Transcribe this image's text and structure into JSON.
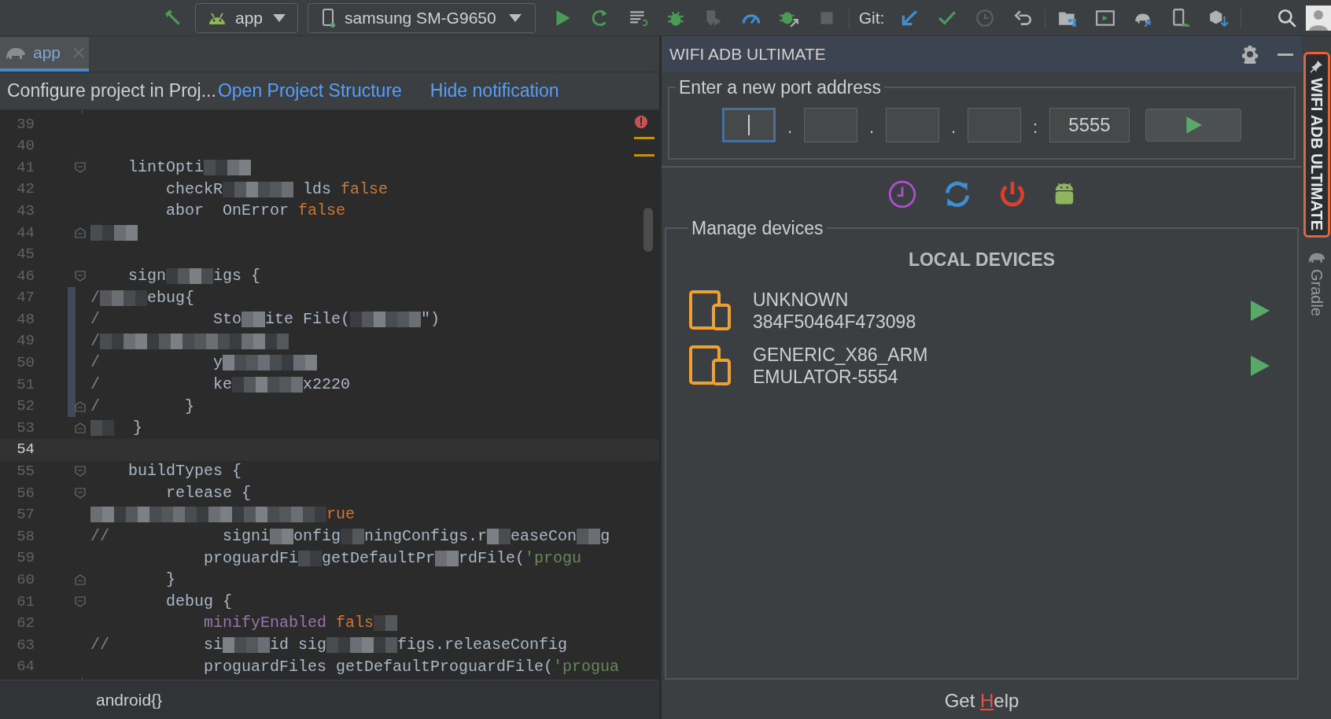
{
  "toolbar": {
    "run_config": "app",
    "device": "samsung SM-G9650",
    "git_label": "Git:"
  },
  "editor_tabs": [
    {
      "label": "app",
      "selected": true
    }
  ],
  "notification": {
    "message": "Configure project in Proj...",
    "actions": [
      "Open Project Structure",
      "Hide notification"
    ]
  },
  "code_lines": [
    {
      "number": "39",
      "current": false,
      "fold_start": false,
      "fold_end": false,
      "changed": false
    },
    {
      "number": "40",
      "current": false,
      "fold_start": false,
      "fold_end": false,
      "changed": false
    },
    {
      "number": "41",
      "current": false,
      "fold_start": true,
      "fold_end": false,
      "changed": false,
      "segments": [
        {
          "kind": "plain",
          "text": "    lintOpti"
        },
        {
          "kind": "blur"
        },
        {
          "kind": "blur"
        }
      ]
    },
    {
      "number": "42",
      "current": false,
      "fold_start": false,
      "fold_end": false,
      "changed": false,
      "segments": [
        {
          "kind": "plain",
          "text": "        checkR"
        },
        {
          "kind": "blur"
        },
        {
          "kind": "blur"
        },
        {
          "kind": "blur"
        },
        {
          "kind": "plain",
          "text": " lds "
        },
        {
          "kind": "keyword",
          "text": "false"
        }
      ]
    },
    {
      "number": "43",
      "current": false,
      "fold_start": false,
      "fold_end": false,
      "changed": false,
      "segments": [
        {
          "kind": "plain",
          "text": "        abor  OnError "
        },
        {
          "kind": "keyword",
          "text": "false"
        }
      ]
    },
    {
      "number": "44",
      "current": false,
      "fold_start": false,
      "fold_end": true,
      "changed": false,
      "segments": [
        {
          "kind": "blur"
        },
        {
          "kind": "blur"
        }
      ]
    },
    {
      "number": "45",
      "current": false,
      "fold_start": false,
      "fold_end": false,
      "changed": false
    },
    {
      "number": "46",
      "current": false,
      "fold_start": true,
      "fold_end": false,
      "changed": false,
      "segments": [
        {
          "kind": "plain",
          "text": "    sign"
        },
        {
          "kind": "blur"
        },
        {
          "kind": "blur"
        },
        {
          "kind": "plain",
          "text": "igs {"
        }
      ]
    },
    {
      "number": "47",
      "current": false,
      "fold_start": false,
      "fold_end": false,
      "changed": true,
      "segments": [
        {
          "kind": "comment",
          "text": "/"
        },
        {
          "kind": "blur"
        },
        {
          "kind": "blur"
        },
        {
          "kind": "plain",
          "text": "ebug{"
        }
      ]
    },
    {
      "number": "48",
      "current": false,
      "fold_start": false,
      "fold_end": false,
      "changed": true,
      "segments": [
        {
          "kind": "comment",
          "text": "/"
        },
        {
          "kind": "plain",
          "text": "            Sto"
        },
        {
          "kind": "blur"
        },
        {
          "kind": "plain",
          "text": "ite File("
        },
        {
          "kind": "blur"
        },
        {
          "kind": "blur"
        },
        {
          "kind": "blur"
        },
        {
          "kind": "plain",
          "text": "\")"
        }
      ]
    },
    {
      "number": "49",
      "current": false,
      "fold_start": false,
      "fold_end": false,
      "changed": true,
      "segments": [
        {
          "kind": "comment",
          "text": "/"
        },
        {
          "kind": "blur"
        },
        {
          "kind": "blur"
        },
        {
          "kind": "blur"
        },
        {
          "kind": "blur"
        },
        {
          "kind": "blur"
        },
        {
          "kind": "blur"
        },
        {
          "kind": "blur"
        },
        {
          "kind": "blur"
        }
      ]
    },
    {
      "number": "50",
      "current": false,
      "fold_start": false,
      "fold_end": false,
      "changed": true,
      "segments": [
        {
          "kind": "comment",
          "text": "/"
        },
        {
          "kind": "plain",
          "text": "            y"
        },
        {
          "kind": "blur"
        },
        {
          "kind": "blur"
        },
        {
          "kind": "blur"
        },
        {
          "kind": "blur"
        }
      ]
    },
    {
      "number": "51",
      "current": false,
      "fold_start": false,
      "fold_end": false,
      "changed": true,
      "segments": [
        {
          "kind": "comment",
          "text": "/"
        },
        {
          "kind": "plain",
          "text": "            ke"
        },
        {
          "kind": "blur"
        },
        {
          "kind": "blur"
        },
        {
          "kind": "blur"
        },
        {
          "kind": "plain",
          "text": "x2220"
        }
      ]
    },
    {
      "number": "52",
      "current": false,
      "fold_start": false,
      "fold_end": true,
      "changed": true,
      "segments": [
        {
          "kind": "comment",
          "text": "/"
        },
        {
          "kind": "plain",
          "text": "         }"
        }
      ]
    },
    {
      "number": "53",
      "current": false,
      "fold_start": false,
      "fold_end": true,
      "changed": false,
      "segments": [
        {
          "kind": "blur"
        },
        {
          "kind": "plain",
          "text": "  }"
        }
      ]
    },
    {
      "number": "54",
      "current": true,
      "fold_start": false,
      "fold_end": false,
      "changed": false
    },
    {
      "number": "55",
      "current": false,
      "fold_start": true,
      "fold_end": false,
      "changed": false,
      "segments": [
        {
          "kind": "plain",
          "text": "    buildTypes {"
        }
      ]
    },
    {
      "number": "56",
      "current": false,
      "fold_start": true,
      "fold_end": false,
      "changed": false,
      "segments": [
        {
          "kind": "plain",
          "text": "        release {"
        }
      ]
    },
    {
      "number": "57",
      "current": false,
      "fold_start": false,
      "fold_end": false,
      "changed": false,
      "segments": [
        {
          "kind": "blur"
        },
        {
          "kind": "blur"
        },
        {
          "kind": "blur"
        },
        {
          "kind": "blur"
        },
        {
          "kind": "blur"
        },
        {
          "kind": "blur"
        },
        {
          "kind": "blur"
        },
        {
          "kind": "blur"
        },
        {
          "kind": "blur"
        },
        {
          "kind": "blur"
        },
        {
          "kind": "keyword",
          "text": "rue"
        }
      ]
    },
    {
      "number": "58",
      "current": false,
      "fold_start": false,
      "fold_end": false,
      "changed": false,
      "segments": [
        {
          "kind": "comment",
          "text": "//"
        },
        {
          "kind": "plain",
          "text": "            signi"
        },
        {
          "kind": "blur"
        },
        {
          "kind": "plain",
          "text": "onfig"
        },
        {
          "kind": "blur"
        },
        {
          "kind": "plain",
          "text": "ningConfigs.r"
        },
        {
          "kind": "blur"
        },
        {
          "kind": "plain",
          "text": "easeCon"
        },
        {
          "kind": "blur"
        },
        {
          "kind": "plain",
          "text": "g"
        }
      ]
    },
    {
      "number": "59",
      "current": false,
      "fold_start": false,
      "fold_end": false,
      "changed": false,
      "segments": [
        {
          "kind": "plain",
          "text": "            proguardFi"
        },
        {
          "kind": "blur"
        },
        {
          "kind": "plain",
          "text": "getDefaultPr"
        },
        {
          "kind": "blur"
        },
        {
          "kind": "plain",
          "text": "rdFile("
        },
        {
          "kind": "string",
          "text": "'progu"
        }
      ]
    },
    {
      "number": "60",
      "current": false,
      "fold_start": false,
      "fold_end": true,
      "changed": false,
      "segments": [
        {
          "kind": "plain",
          "text": "        }"
        }
      ]
    },
    {
      "number": "61",
      "current": false,
      "fold_start": true,
      "fold_end": false,
      "changed": false,
      "segments": [
        {
          "kind": "plain",
          "text": "        debug {"
        }
      ]
    },
    {
      "number": "62",
      "current": false,
      "fold_start": false,
      "fold_end": false,
      "changed": false,
      "segments": [
        {
          "kind": "field",
          "text": "            minifyEnabled"
        },
        {
          "kind": "keyword",
          "text": " fals"
        },
        {
          "kind": "blur"
        }
      ]
    },
    {
      "number": "63",
      "current": false,
      "fold_start": false,
      "fold_end": false,
      "changed": false,
      "segments": [
        {
          "kind": "comment",
          "text": "//"
        },
        {
          "kind": "plain",
          "text": "          si"
        },
        {
          "kind": "blur"
        },
        {
          "kind": "blur"
        },
        {
          "kind": "plain",
          "text": "id sig"
        },
        {
          "kind": "blur"
        },
        {
          "kind": "blur"
        },
        {
          "kind": "blur"
        },
        {
          "kind": "plain",
          "text": "figs.releaseConfig"
        }
      ]
    },
    {
      "number": "64",
      "current": false,
      "fold_start": false,
      "fold_end": false,
      "changed": false,
      "segments": [
        {
          "kind": "plain",
          "text": "            proguardFiles getDefaultProguardFile("
        },
        {
          "kind": "string",
          "text": "'progua"
        }
      ]
    }
  ],
  "breadcrumb": "android{}",
  "tool_window": {
    "title": "WIFI ADB ULTIMATE",
    "port_group": {
      "legend": "Enter a new port address",
      "ip_fields": [
        {
          "focused": true
        },
        {
          "focused": false
        },
        {
          "focused": false
        },
        {
          "focused": false
        }
      ],
      "separators": [
        ".",
        ".",
        ".",
        ":"
      ],
      "port": "5555"
    },
    "devices_group": {
      "legend": "Manage devices",
      "section": "LOCAL DEVICES",
      "devices": [
        {
          "name": "UNKNOWN",
          "serial": "384F50464F473098"
        },
        {
          "name": "GENERIC_X86_ARM",
          "serial": "EMULATOR-5554"
        }
      ]
    },
    "help_parts": [
      "Get ",
      "H",
      "elp"
    ]
  },
  "side_tabs": [
    {
      "label": "WIFI ADB ULTIMATE",
      "selected": true
    },
    {
      "label": "Gradle",
      "selected": false
    }
  ]
}
